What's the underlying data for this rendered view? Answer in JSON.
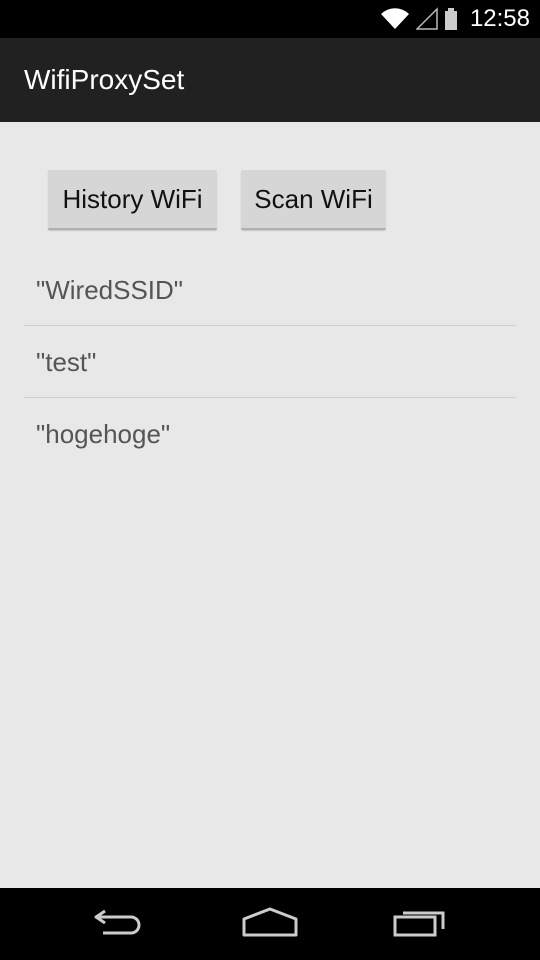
{
  "status_bar": {
    "time": "12:58",
    "icons": [
      "wifi-icon",
      "cell-signal-icon",
      "battery-icon"
    ]
  },
  "action_bar": {
    "title": "WifiProxySet"
  },
  "buttons": {
    "history_label": "History WiFi",
    "scan_label": "Scan WiFi"
  },
  "wifi_list": {
    "items": [
      "\"WiredSSID\"",
      "\"test\"",
      "\"hogehoge\""
    ]
  },
  "nav_bar": {
    "icons": [
      "back-icon",
      "home-icon",
      "recents-icon"
    ]
  },
  "colors": {
    "background": "#e8e8e8",
    "action_bar": "#212121",
    "button": "#d6d6d6",
    "list_text": "#555555"
  }
}
